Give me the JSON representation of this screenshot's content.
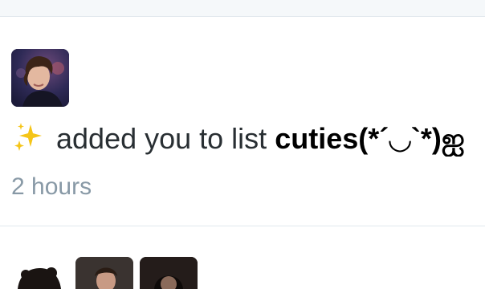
{
  "notification": {
    "action_text": "added you to list",
    "list_name": "cuties(*´◡`*)ஐ",
    "time_ago": "2 hours",
    "icons": {
      "sparkles": "sparkles-icon"
    },
    "colors": {
      "text": "#292f33",
      "muted": "#8899a6",
      "divider": "#e1e8ed",
      "sparkle": "#f5c518"
    }
  }
}
